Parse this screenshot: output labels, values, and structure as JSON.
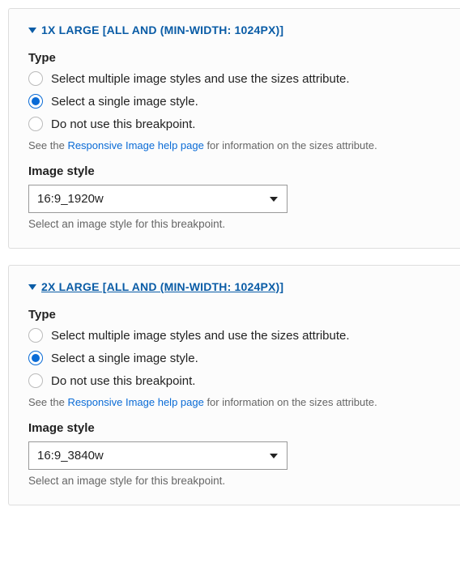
{
  "panels": [
    {
      "title": "1X LARGE [ALL AND (MIN-WIDTH: 1024PX)]",
      "hovered": false,
      "type_label": "Type",
      "options": [
        {
          "label": "Select multiple image styles and use the sizes attribute.",
          "checked": false
        },
        {
          "label": "Select a single image style.",
          "checked": true
        },
        {
          "label": "Do not use this breakpoint.",
          "checked": false
        }
      ],
      "help_prefix": "See the ",
      "help_link": "Responsive Image help page",
      "help_suffix": " for information on the sizes attribute.",
      "image_style_label": "Image style",
      "image_style_value": "16:9_1920w",
      "image_style_desc": "Select an image style for this breakpoint."
    },
    {
      "title": "2X LARGE [ALL AND (MIN-WIDTH: 1024PX)]",
      "hovered": true,
      "type_label": "Type",
      "options": [
        {
          "label": "Select multiple image styles and use the sizes attribute.",
          "checked": false
        },
        {
          "label": "Select a single image style.",
          "checked": true
        },
        {
          "label": "Do not use this breakpoint.",
          "checked": false
        }
      ],
      "help_prefix": "See the ",
      "help_link": "Responsive Image help page",
      "help_suffix": " for information on the sizes attribute.",
      "image_style_label": "Image style",
      "image_style_value": "16:9_3840w",
      "image_style_desc": "Select an image style for this breakpoint."
    }
  ]
}
